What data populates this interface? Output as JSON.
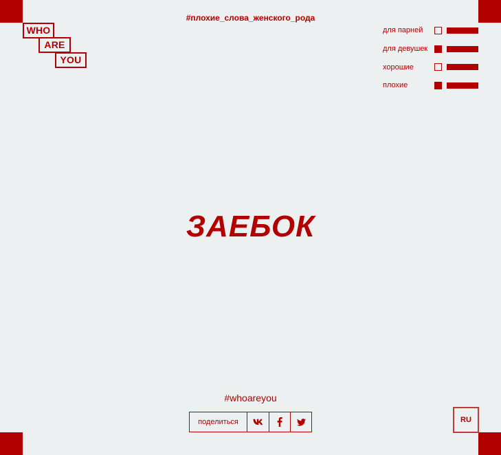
{
  "logo": {
    "words": [
      "WHO",
      "ARE",
      "YOU"
    ]
  },
  "header": {
    "hashtag": "#плохие_слова_женского_рода"
  },
  "filters": [
    {
      "label": "для парней",
      "checked": false
    },
    {
      "label": "для девушек",
      "checked": true
    },
    {
      "label": "хорошие",
      "checked": false
    },
    {
      "label": "плохие",
      "checked": true
    }
  ],
  "main": {
    "word": "ЗАЕБОК"
  },
  "footer": {
    "hashtag": "#whoareyou",
    "share_label": "поделиться",
    "share_icons": [
      "vk-icon",
      "facebook-icon",
      "twitter-icon"
    ],
    "language": "RU"
  },
  "colors": {
    "accent": "#b20000",
    "background": "#edf0f1"
  }
}
